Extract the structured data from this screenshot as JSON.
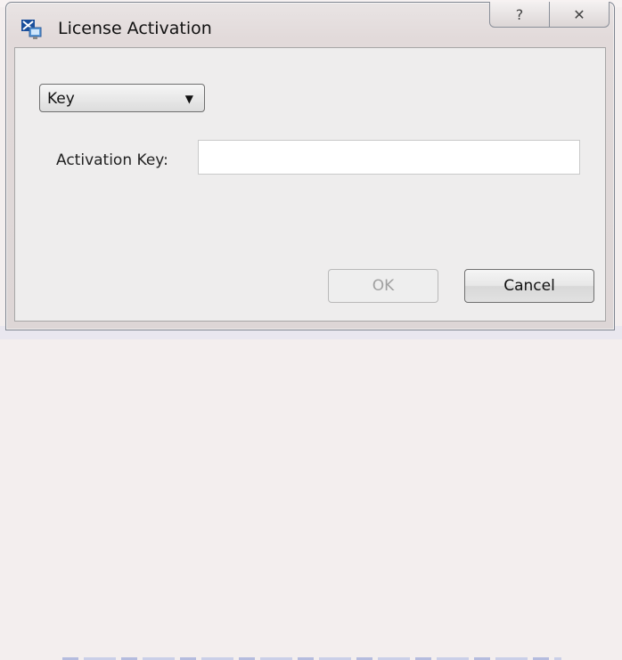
{
  "window": {
    "title": "License Activation",
    "icon": "license-activation-app-icon",
    "caption_buttons": {
      "help_glyph": "?",
      "close_glyph": "✕"
    }
  },
  "form": {
    "type_select": {
      "selected": "Key"
    },
    "activation_key": {
      "label": "Activation Key:",
      "value": ""
    }
  },
  "buttons": {
    "ok_label": "OK",
    "cancel_label": "Cancel"
  }
}
